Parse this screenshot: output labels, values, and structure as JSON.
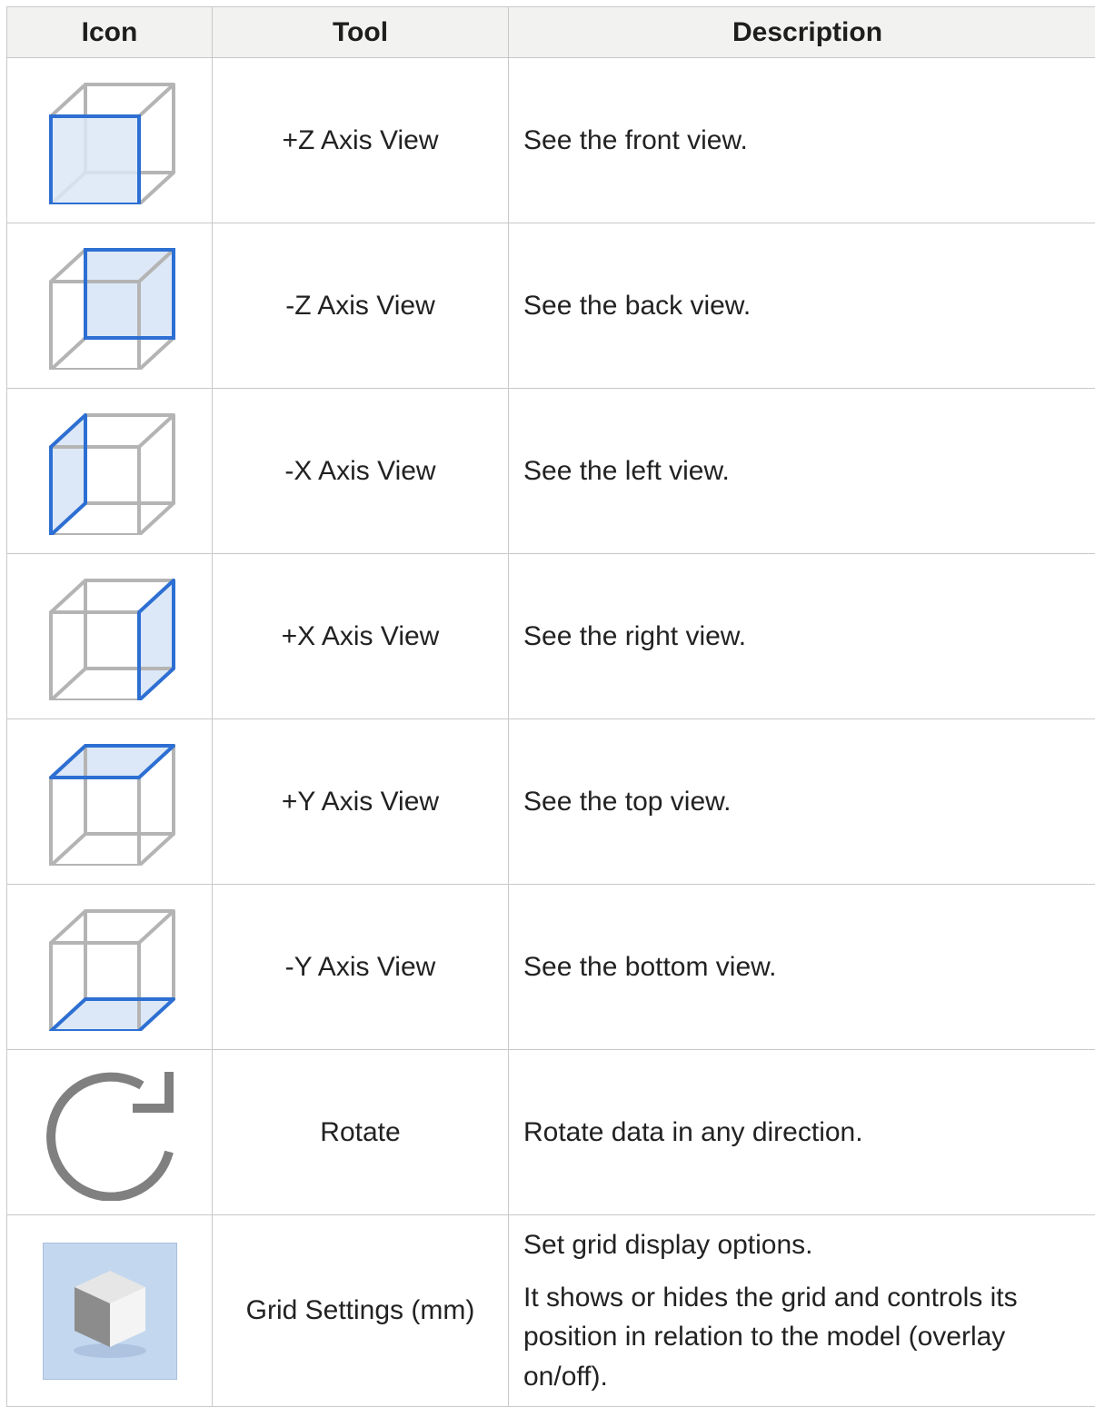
{
  "table": {
    "headers": {
      "icon": "Icon",
      "tool": "Tool",
      "description": "Description"
    },
    "rows": [
      {
        "icon": "cube-front-face-icon",
        "tool": "+Z Axis View",
        "description": [
          "See the front view."
        ]
      },
      {
        "icon": "cube-back-face-icon",
        "tool": "-Z Axis View",
        "description": [
          "See the back view."
        ]
      },
      {
        "icon": "cube-left-face-icon",
        "tool": "-X Axis View",
        "description": [
          "See the left view."
        ]
      },
      {
        "icon": "cube-right-face-icon",
        "tool": "+X Axis View",
        "description": [
          "See the right view."
        ]
      },
      {
        "icon": "cube-top-face-icon",
        "tool": "+Y Axis View",
        "description": [
          "See the top view."
        ]
      },
      {
        "icon": "cube-bottom-face-icon",
        "tool": "-Y Axis View",
        "description": [
          "See the bottom view."
        ]
      },
      {
        "icon": "rotate-arrow-icon",
        "tool": "Rotate",
        "description": [
          "Rotate data in any direction."
        ]
      },
      {
        "icon": "grid-settings-cube-icon",
        "tool": "Grid Settings (mm)",
        "description": [
          "Set grid display options.",
          "It shows or hides the grid and controls its position in relation to the model (overlay on/off)."
        ]
      }
    ]
  },
  "colors": {
    "highlight_edge": "#2d6fd2",
    "highlight_fill": "#dce8f7",
    "cube_edge": "#b4b4b4",
    "rotate_icon": "#808080",
    "grid_icon_bg": "#c3d7ef"
  }
}
